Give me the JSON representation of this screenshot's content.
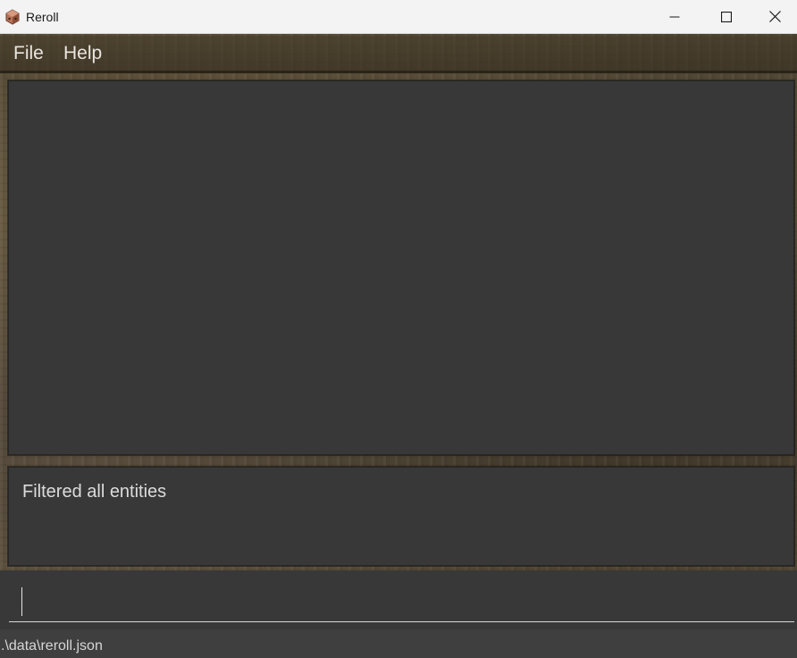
{
  "window": {
    "title": "Reroll",
    "icon": "dice-app-icon"
  },
  "menu": {
    "items": [
      {
        "label": "File"
      },
      {
        "label": "Help"
      }
    ]
  },
  "result": {
    "message": "Filtered all entities"
  },
  "command": {
    "value": "",
    "placeholder": ""
  },
  "status": {
    "file_path": ".\\data\\reroll.json"
  },
  "colors": {
    "panel_background": "#383838",
    "texture_base": "#5a4f3a",
    "text_primary": "#dcdcdc",
    "titlebar": "#f3f3f3"
  }
}
